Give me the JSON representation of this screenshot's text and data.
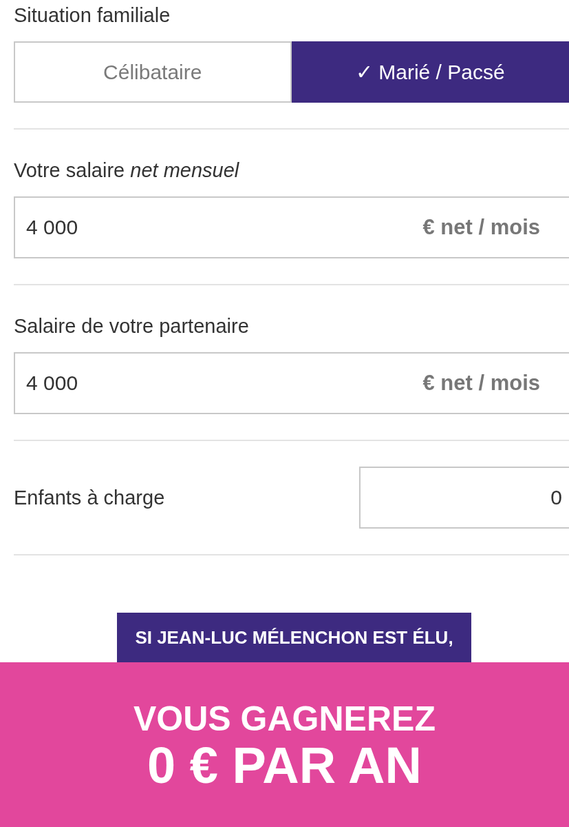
{
  "situation": {
    "label": "Situation familiale",
    "options": [
      {
        "label": "Célibataire",
        "selected": false
      },
      {
        "label": "✓ Marié / Pacsé",
        "selected": true
      }
    ]
  },
  "fields": [
    {
      "kind": "amount",
      "label": "Votre salaire *net mensuel*",
      "value": "4 000",
      "unit": "€ net / mois"
    },
    {
      "kind": "amount",
      "label": "Salaire de votre partenaire",
      "value": "4 000",
      "unit": "€ net / mois"
    },
    {
      "kind": "count",
      "label": "Enfants à charge",
      "value": "0"
    }
  ],
  "result": {
    "banner": "SI JEAN-LUC MÉLENCHON EST ÉLU,",
    "headline": "VOUS GAGNEREZ",
    "amount": "0 € PAR AN"
  }
}
